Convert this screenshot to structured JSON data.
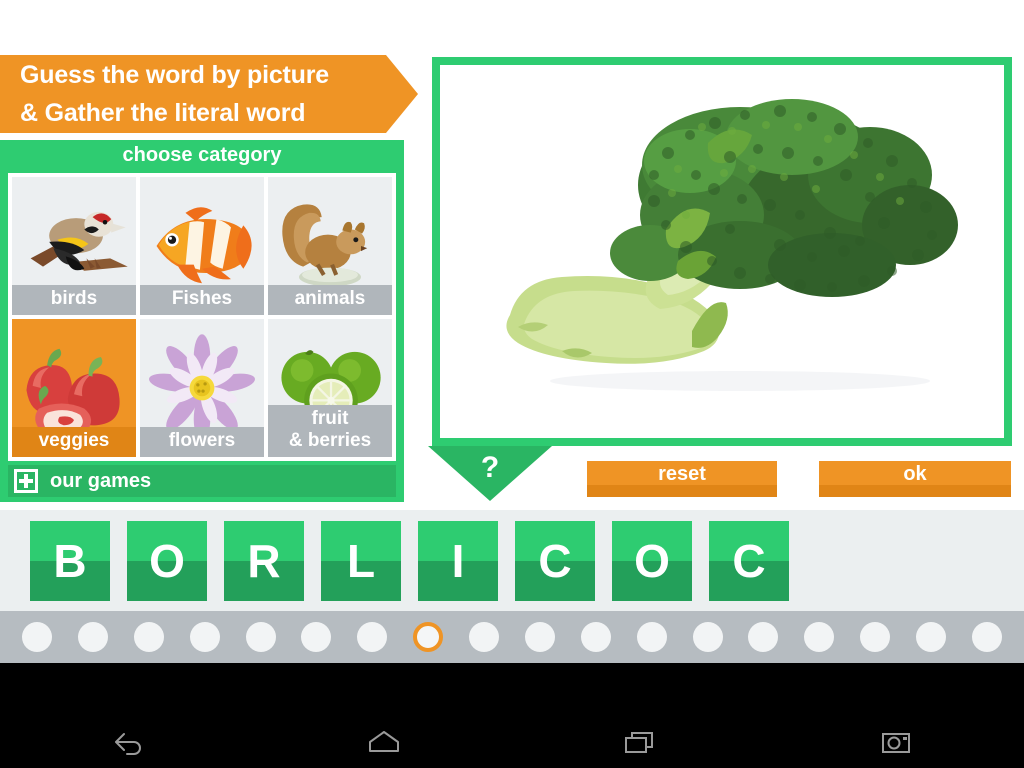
{
  "banner": {
    "line1": "Guess the word by picture",
    "line2": "& Gather the literal word",
    "color": "#ef9425"
  },
  "sidebar": {
    "title": "choose category",
    "accent": "#2ecc71",
    "categories": [
      {
        "label": "birds",
        "icon": "bird-icon",
        "selected": false
      },
      {
        "label": "Fishes",
        "icon": "fish-icon",
        "selected": false
      },
      {
        "label": "animals",
        "icon": "squirrel-icon",
        "selected": false
      },
      {
        "label": "veggies",
        "icon": "pepper-icon",
        "selected": true
      },
      {
        "label": "flowers",
        "icon": "lotus-icon",
        "selected": false
      },
      {
        "label": "fruit\n& berries",
        "icon": "lime-icon",
        "selected": false
      }
    ],
    "our_games_label": "our games",
    "our_games_icon": "plus-box-icon"
  },
  "picture": {
    "subject": "broccoli-photo",
    "frame_color": "#2ecc71"
  },
  "hint": {
    "label": "?",
    "icon": "hint-triangle-icon"
  },
  "actions": {
    "reset_label": "reset",
    "ok_label": "ok",
    "color": "#ef9425"
  },
  "word_rack": {
    "letters": [
      "B",
      "O",
      "R",
      "L",
      "I",
      "C",
      "O",
      "C"
    ],
    "tile_color_top": "#2ecc71",
    "tile_color_bottom": "#23a05a"
  },
  "progress": {
    "total_dots": 18,
    "active_index": 7,
    "active_ring_color": "#ef9425",
    "strip_color": "#b6bcc1"
  },
  "navbar": {
    "buttons": [
      {
        "name": "back-icon",
        "label": "Back"
      },
      {
        "name": "home-icon",
        "label": "Home"
      },
      {
        "name": "recents-icon",
        "label": "Recents"
      },
      {
        "name": "screenshot-icon",
        "label": "Screenshot"
      }
    ]
  }
}
